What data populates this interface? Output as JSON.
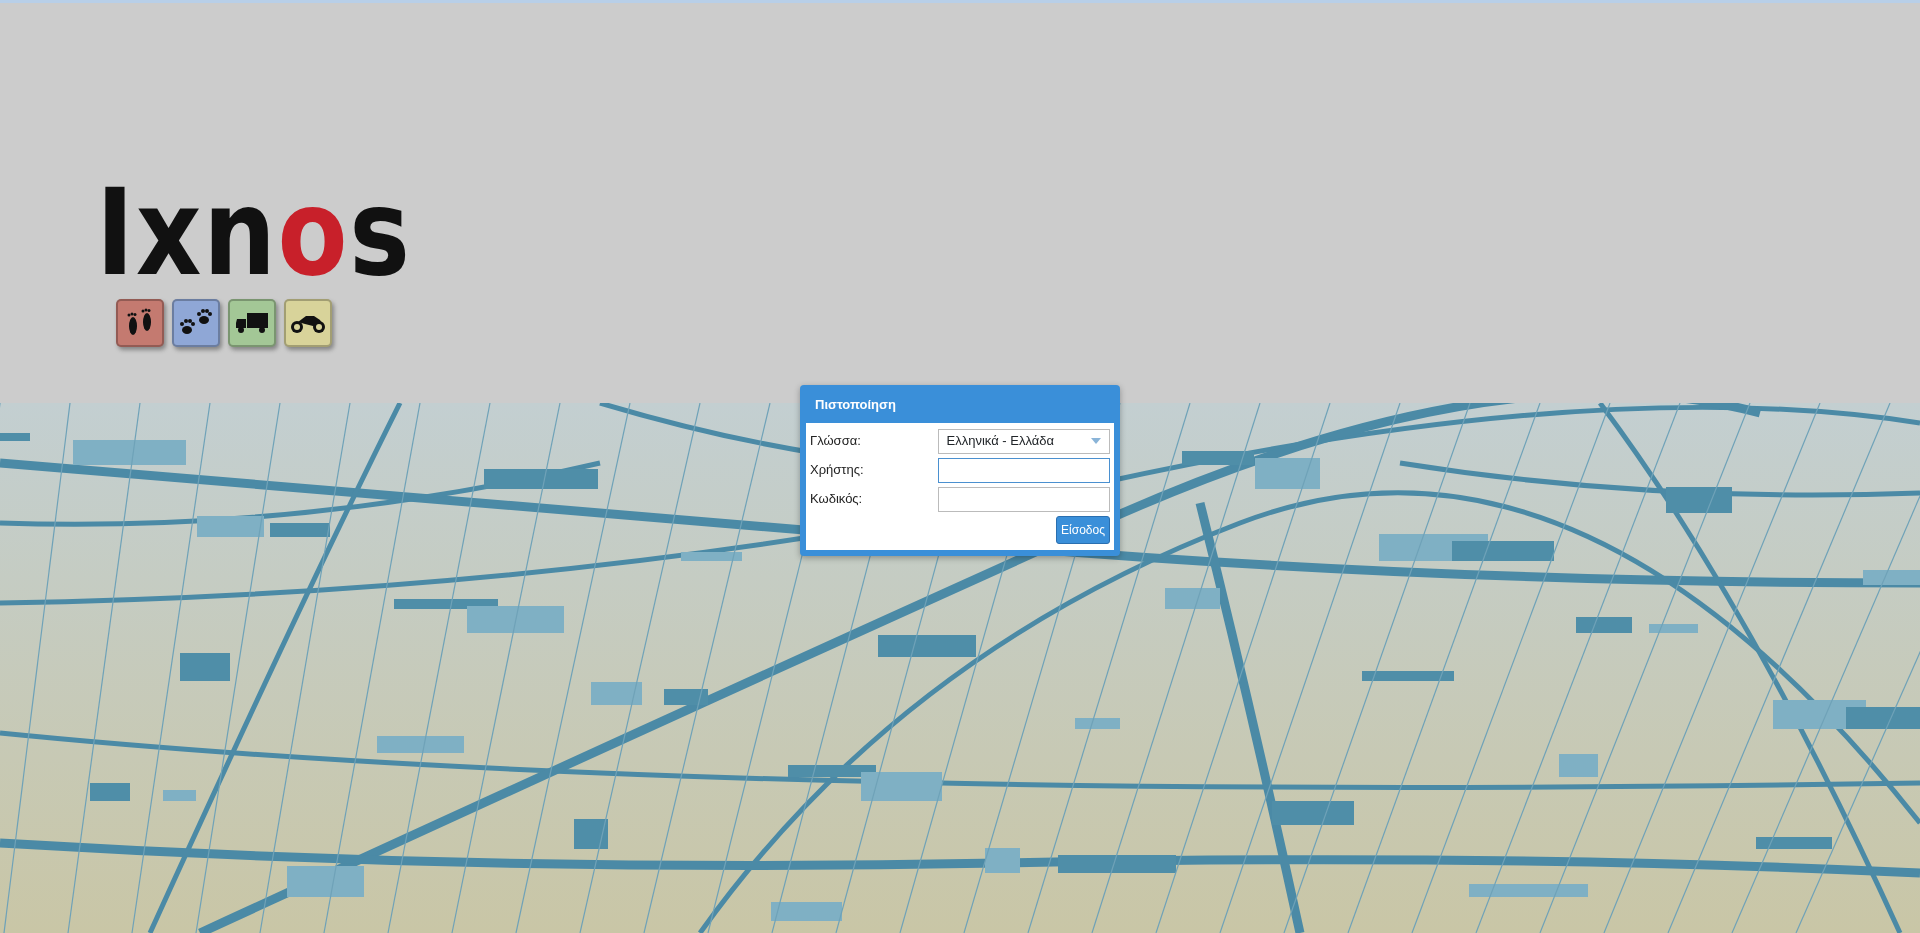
{
  "logo": {
    "parts": [
      {
        "text": "Ixn",
        "color": "#111111"
      },
      {
        "text": "o",
        "color": "#c8202a"
      },
      {
        "text": "s",
        "color": "#111111"
      }
    ]
  },
  "tiles": [
    {
      "kind": "feet",
      "color": "#c47a70"
    },
    {
      "kind": "paws",
      "color": "#8fa7d6"
    },
    {
      "kind": "truck",
      "color": "#a3c796"
    },
    {
      "kind": "motorcycle",
      "color": "#d8d39a"
    }
  ],
  "login": {
    "title": "Πιστοποίηση",
    "fields": [
      {
        "kind": "select",
        "label": "Γλώσσα:",
        "value": "Ελληνικά - Ελλάδα",
        "focused": false
      },
      {
        "kind": "text",
        "label": "Χρήστης:",
        "focused": true
      },
      {
        "kind": "password",
        "label": "Κωδικός:",
        "focused": false
      }
    ],
    "button": "Είσοδος"
  }
}
